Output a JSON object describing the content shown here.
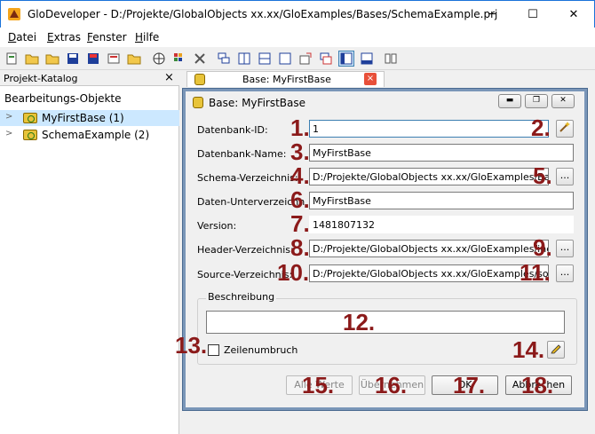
{
  "window": {
    "title": "GloDeveloper - D:/Projekte/GlobalObjects xx.xx/GloExamples/Bases/SchemaExample.prj",
    "minimize": "─",
    "maximize": "☐",
    "close": "✕"
  },
  "menu": [
    "Datei",
    "Extras",
    "Fenster",
    "Hilfe"
  ],
  "left_panel": {
    "title": "Projekt-Katalog",
    "close": "×",
    "section": "Bearbeitungs-Objekte",
    "items": [
      {
        "label": "MyFirstBase (1)",
        "selected": true
      },
      {
        "label": "SchemaExample (2)",
        "selected": false
      }
    ]
  },
  "tab": {
    "label": "Base: MyFirstBase",
    "close": "×"
  },
  "dialog": {
    "title": "Base: MyFirstBase",
    "buttons": {
      "minimize": "▬",
      "restore": "❐",
      "close": "✕"
    },
    "fields": {
      "datenbank_id": {
        "label": "Datenbank-ID:",
        "value": "1"
      },
      "datenbank_name": {
        "label": "Datenbank-Name:",
        "value": "MyFirstBase"
      },
      "schema_verzeichnis": {
        "label": "Schema-Verzeichnis:",
        "value": "D:/Projekte/GlobalObjects xx.xx/GloExamples/Bases/"
      },
      "daten_unterverzeichnis": {
        "label": "Daten-Unterverzeichnis:",
        "value": "MyFirstBase"
      },
      "version": {
        "label": "Version:",
        "value": "1481807132"
      },
      "header_verzeichnis": {
        "label": "Header-Verzeichnis:",
        "value": "D:/Projekte/GlobalObjects xx.xx/GloExamples/include/"
      },
      "source_verzeichnis": {
        "label": "Source-Verzeichnis:",
        "value": "D:/Projekte/GlobalObjects xx.xx/GloExamples/source/"
      }
    },
    "browse": "...",
    "description_group": "Beschreibung",
    "description_value": "",
    "line_wrap": {
      "label": "Zeilenumbruch",
      "checked": false
    },
    "action_buttons": {
      "apply": "Alle Werte",
      "take_over": "Übernehmen",
      "ok": "OK",
      "cancel": "Abbrechen"
    }
  },
  "annotations": [
    "1.",
    "2.",
    "3.",
    "4.",
    "5.",
    "6.",
    "7.",
    "8.",
    "9.",
    "10.",
    "11.",
    "12.",
    "13.",
    "14.",
    "15.",
    "16.",
    "17.",
    "18."
  ],
  "colors": {
    "accent": "#1a73d9",
    "annotation": "#8b1a1a",
    "selection": "#cce8ff"
  }
}
